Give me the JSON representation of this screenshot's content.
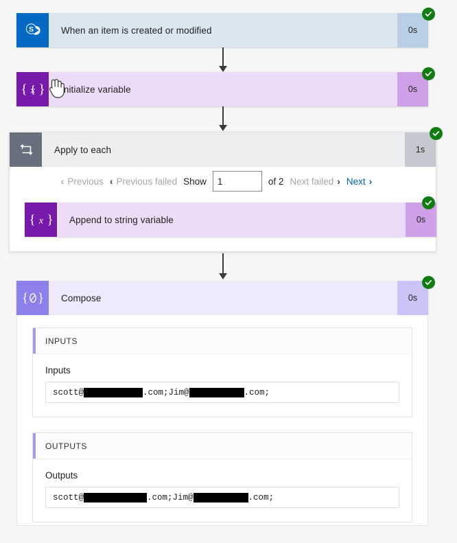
{
  "flow": {
    "steps": [
      {
        "id": "trigger",
        "title": "When an item is created or modified",
        "duration": "0s",
        "icon": "sharepoint-icon",
        "status": "succeeded"
      },
      {
        "id": "initialize-variable",
        "title": "Initialize variable",
        "duration": "0s",
        "icon": "variable-icon",
        "status": "succeeded"
      },
      {
        "id": "apply-to-each",
        "title": "Apply to each",
        "duration": "1s",
        "icon": "loop-icon",
        "status": "succeeded"
      },
      {
        "id": "append-to-string-variable",
        "title": "Append to string variable",
        "duration": "0s",
        "icon": "variable-icon",
        "status": "succeeded"
      },
      {
        "id": "compose",
        "title": "Compose",
        "duration": "0s",
        "icon": "compose-icon",
        "status": "succeeded"
      }
    ]
  },
  "pagination": {
    "previous_label": "Previous",
    "previous_failed_label": "Previous failed",
    "show_label": "Show",
    "current_page": "1",
    "of_label": "of 2",
    "next_failed_label": "Next failed",
    "next_label": "Next",
    "chevron_left": "‹",
    "chevron_right": "›"
  },
  "compose_details": {
    "inputs": {
      "section_label": "INPUTS",
      "field_label": "Inputs",
      "value_prefix": "scott@",
      "value_mid": ".com;Jim@",
      "value_suffix": ".com;",
      "redaction_1_width": "86",
      "redaction_2_width": "80"
    },
    "outputs": {
      "section_label": "OUTPUTS",
      "field_label": "Outputs",
      "value_prefix": "scott@",
      "value_mid": ".com;Jim@",
      "value_suffix": ".com;",
      "redaction_1_width": "92",
      "redaction_2_width": "80"
    }
  },
  "colors": {
    "sharepoint_blue": "#036ac4",
    "variable_purple": "#7719aa",
    "compose_purple": "#8c81ec",
    "loop_gray": "#69707d",
    "success_green": "#107c10",
    "link_blue": "#0063b1",
    "disabled_gray": "#a6a6a6",
    "accent_bar": "#a79bec"
  }
}
